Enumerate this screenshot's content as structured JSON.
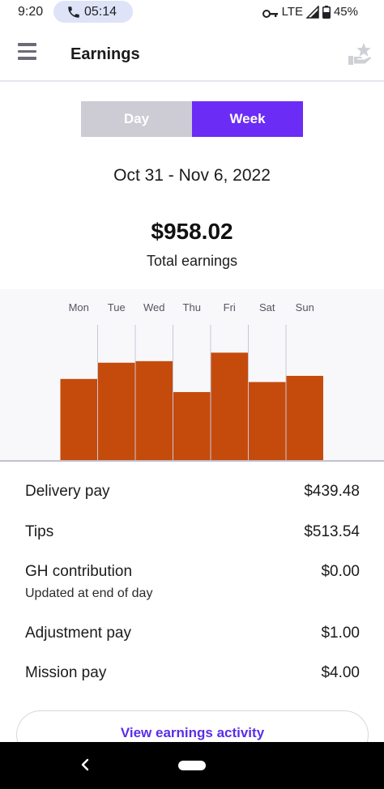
{
  "status_bar": {
    "time": "9:20",
    "call_time": "05:14",
    "network": "LTE",
    "battery": "45%"
  },
  "header": {
    "title": "Earnings",
    "menu_icon": "hamburger-menu-icon",
    "action_icon": "star-hand-icon"
  },
  "period_toggle": {
    "day_label": "Day",
    "week_label": "Week",
    "selected": "Week"
  },
  "summary": {
    "date_range": "Oct 31 - Nov 6, 2022",
    "total_amount": "$958.02",
    "total_label": "Total earnings"
  },
  "chart_data": {
    "type": "bar",
    "categories": [
      "Mon",
      "Tue",
      "Wed",
      "Thu",
      "Fri",
      "Sat",
      "Sun"
    ],
    "values": [
      105,
      126,
      128,
      88,
      139,
      101,
      109
    ],
    "ylim": [
      0,
      175
    ],
    "bar_color": "#c54b0c",
    "grid": false,
    "legend": "none"
  },
  "breakdown": {
    "delivery_pay": {
      "label": "Delivery pay",
      "value": "$439.48"
    },
    "tips": {
      "label": "Tips",
      "value": "$513.54"
    },
    "gh_contribution": {
      "label": "GH contribution",
      "value": "$0.00",
      "note": "Updated at end of day"
    },
    "adjustment_pay": {
      "label": "Adjustment pay",
      "value": "$1.00"
    },
    "mission_pay": {
      "label": "Mission pay",
      "value": "$4.00"
    }
  },
  "actions": {
    "view_activity_label": "View earnings activity"
  },
  "colors": {
    "accent": "#6b2cf5",
    "bar": "#c54b0c",
    "toggle_inactive": "#cdccd4"
  }
}
